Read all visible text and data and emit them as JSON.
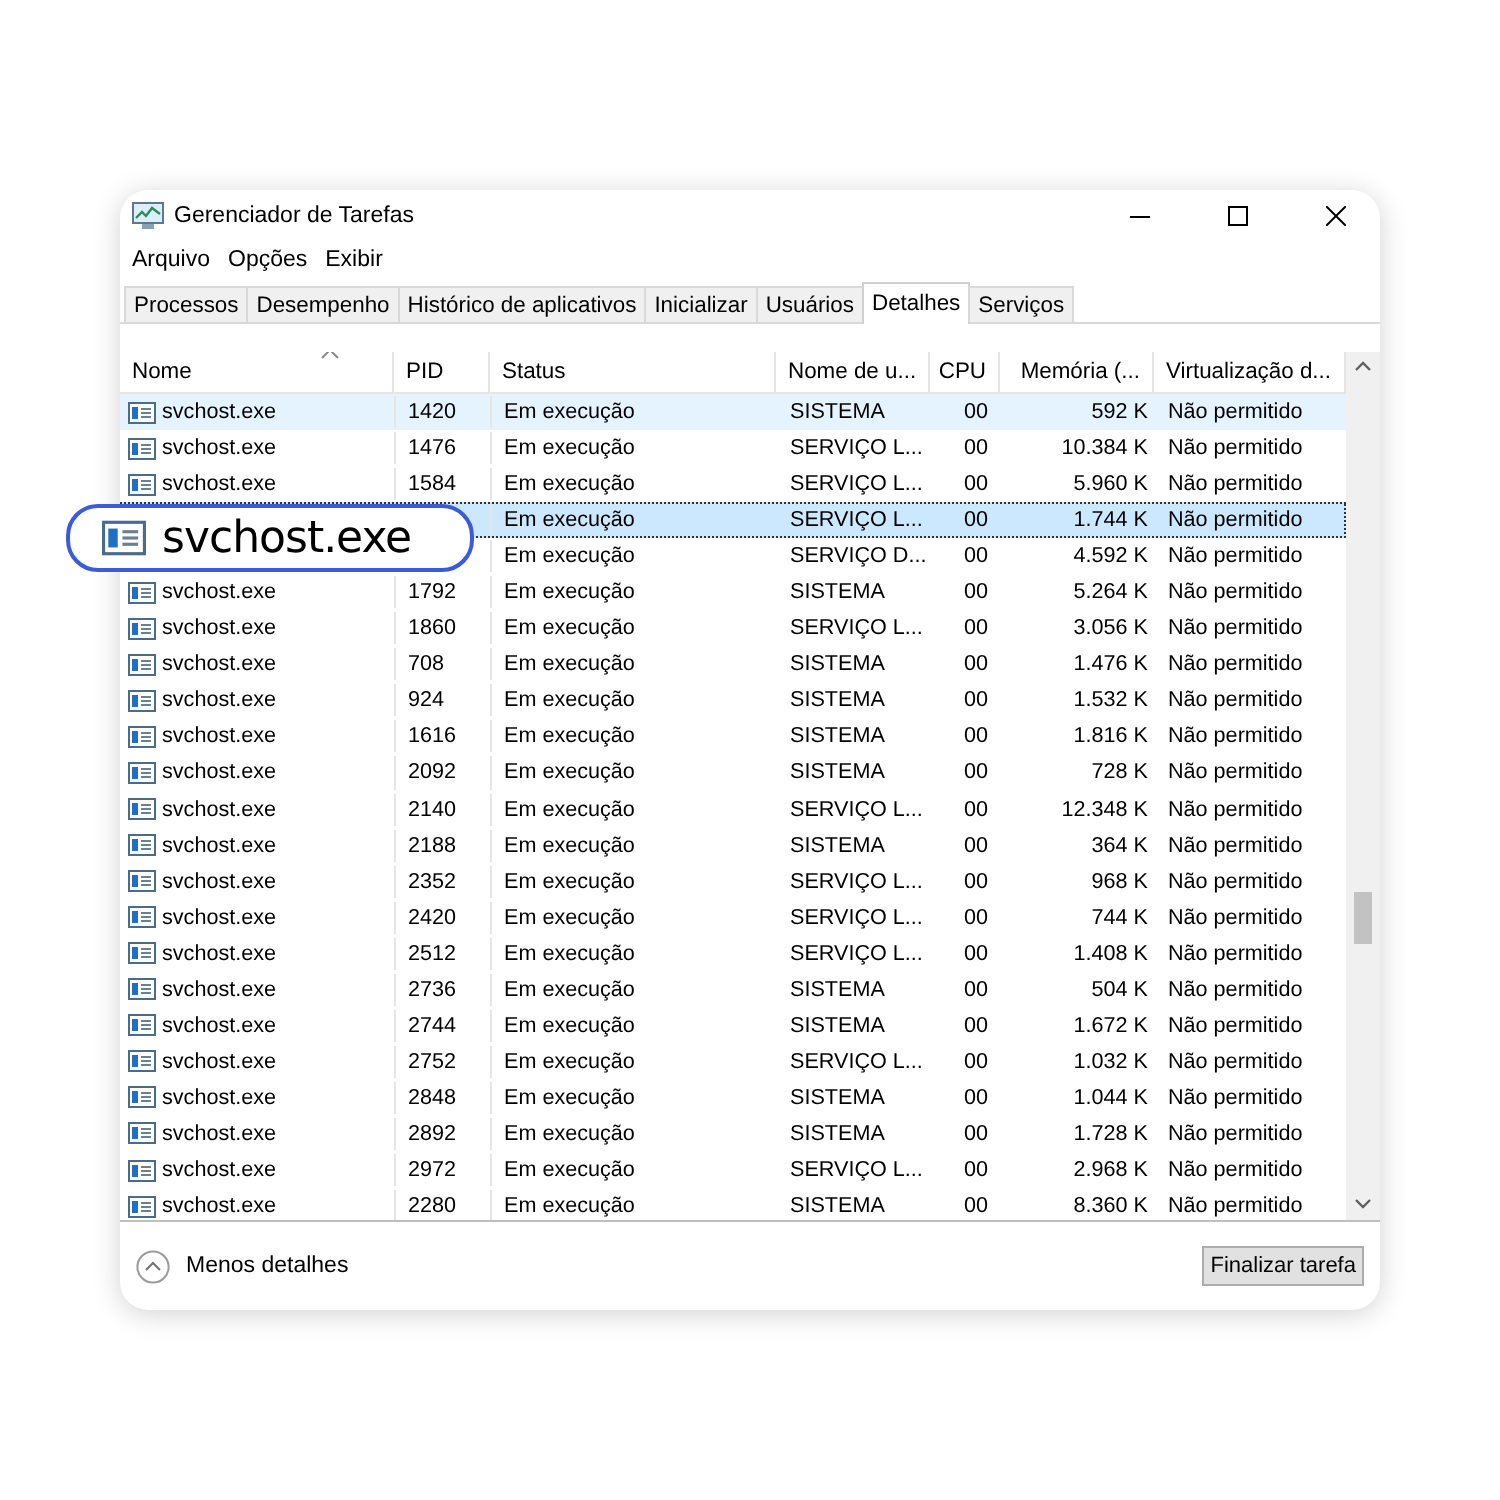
{
  "window": {
    "title": "Gerenciador de Tarefas"
  },
  "menu": [
    "Arquivo",
    "Opções",
    "Exibir"
  ],
  "tabs": [
    {
      "label": "Processos",
      "selected": false
    },
    {
      "label": "Desempenho",
      "selected": false
    },
    {
      "label": "Histórico de aplicativos",
      "selected": false
    },
    {
      "label": "Inicializar",
      "selected": false
    },
    {
      "label": "Usuários",
      "selected": false
    },
    {
      "label": "Detalhes",
      "selected": true
    },
    {
      "label": "Serviços",
      "selected": false
    }
  ],
  "table": {
    "columns": [
      "Nome",
      "PID",
      "Status",
      "Nome de u...",
      "CPU",
      "Memória (...",
      "Virtualização d..."
    ],
    "rows": [
      {
        "name": "svchost.exe",
        "pid": "1420",
        "status": "Em execução",
        "user": "SISTEMA",
        "cpu": "00",
        "memory": "592 K",
        "virtualization": "Não permitido",
        "hover": true,
        "selected": false
      },
      {
        "name": "svchost.exe",
        "pid": "1476",
        "status": "Em execução",
        "user": "SERVIÇO L...",
        "cpu": "00",
        "memory": "10.384 K",
        "virtualization": "Não permitido",
        "hover": false,
        "selected": false
      },
      {
        "name": "svchost.exe",
        "pid": "1584",
        "status": "Em execução",
        "user": "SERVIÇO L...",
        "cpu": "00",
        "memory": "5.960 K",
        "virtualization": "Não permitido",
        "hover": false,
        "selected": false
      },
      {
        "status": "Em execução",
        "user": "SERVIÇO L...",
        "cpu": "00",
        "memory": "1.744 K",
        "virtualization": "Não permitido",
        "hover": false,
        "selected": true
      },
      {
        "status": "Em execução",
        "user": "SERVIÇO D...",
        "cpu": "00",
        "memory": "4.592 K",
        "virtualization": "Não permitido",
        "hover": false,
        "selected": false
      },
      {
        "name": "svchost.exe",
        "pid": "1792",
        "status": "Em execução",
        "user": "SISTEMA",
        "cpu": "00",
        "memory": "5.264 K",
        "virtualization": "Não permitido",
        "hover": false,
        "selected": false
      },
      {
        "name": "svchost.exe",
        "pid": "1860",
        "status": "Em execução",
        "user": "SERVIÇO L...",
        "cpu": "00",
        "memory": "3.056 K",
        "virtualization": "Não permitido",
        "hover": false,
        "selected": false
      },
      {
        "name": "svchost.exe",
        "pid": "708",
        "status": "Em execução",
        "user": "SISTEMA",
        "cpu": "00",
        "memory": "1.476 K",
        "virtualization": "Não permitido",
        "hover": false,
        "selected": false
      },
      {
        "name": "svchost.exe",
        "pid": "924",
        "status": "Em execução",
        "user": "SISTEMA",
        "cpu": "00",
        "memory": "1.532 K",
        "virtualization": "Não permitido",
        "hover": false,
        "selected": false
      },
      {
        "name": "svchost.exe",
        "pid": "1616",
        "status": "Em execução",
        "user": "SISTEMA",
        "cpu": "00",
        "memory": "1.816 K",
        "virtualization": "Não permitido",
        "hover": false,
        "selected": false
      },
      {
        "name": "svchost.exe",
        "pid": "2092",
        "status": "Em execução",
        "user": "SISTEMA",
        "cpu": "00",
        "memory": "728 K",
        "virtualization": "Não permitido",
        "hover": false,
        "selected": false
      },
      {
        "name": "svchost.exe",
        "pid": "2140",
        "status": "Em execução",
        "user": "SERVIÇO L...",
        "cpu": "00",
        "memory": "12.348 K",
        "virtualization": "Não permitido",
        "hover": false,
        "selected": false
      },
      {
        "name": "svchost.exe",
        "pid": "2188",
        "status": "Em execução",
        "user": "SISTEMA",
        "cpu": "00",
        "memory": "364 K",
        "virtualization": "Não permitido",
        "hover": false,
        "selected": false
      },
      {
        "name": "svchost.exe",
        "pid": "2352",
        "status": "Em execução",
        "user": "SERVIÇO L...",
        "cpu": "00",
        "memory": "968 K",
        "virtualization": "Não permitido",
        "hover": false,
        "selected": false
      },
      {
        "name": "svchost.exe",
        "pid": "2420",
        "status": "Em execução",
        "user": "SERVIÇO L...",
        "cpu": "00",
        "memory": "744 K",
        "virtualization": "Não permitido",
        "hover": false,
        "selected": false
      },
      {
        "name": "svchost.exe",
        "pid": "2512",
        "status": "Em execução",
        "user": "SERVIÇO L...",
        "cpu": "00",
        "memory": "1.408 K",
        "virtualization": "Não permitido",
        "hover": false,
        "selected": false
      },
      {
        "name": "svchost.exe",
        "pid": "2736",
        "status": "Em execução",
        "user": "SISTEMA",
        "cpu": "00",
        "memory": "504 K",
        "virtualization": "Não permitido",
        "hover": false,
        "selected": false
      },
      {
        "name": "svchost.exe",
        "pid": "2744",
        "status": "Em execução",
        "user": "SISTEMA",
        "cpu": "00",
        "memory": "1.672 K",
        "virtualization": "Não permitido",
        "hover": false,
        "selected": false
      },
      {
        "name": "svchost.exe",
        "pid": "2752",
        "status": "Em execução",
        "user": "SERVIÇO L...",
        "cpu": "00",
        "memory": "1.032 K",
        "virtualization": "Não permitido",
        "hover": false,
        "selected": false
      },
      {
        "name": "svchost.exe",
        "pid": "2848",
        "status": "Em execução",
        "user": "SISTEMA",
        "cpu": "00",
        "memory": "1.044 K",
        "virtualization": "Não permitido",
        "hover": false,
        "selected": false
      },
      {
        "name": "svchost.exe",
        "pid": "2892",
        "status": "Em execução",
        "user": "SISTEMA",
        "cpu": "00",
        "memory": "1.728 K",
        "virtualization": "Não permitido",
        "hover": false,
        "selected": false
      },
      {
        "name": "svchost.exe",
        "pid": "2972",
        "status": "Em execução",
        "user": "SERVIÇO L...",
        "cpu": "00",
        "memory": "2.968 K",
        "virtualization": "Não permitido",
        "hover": false,
        "selected": false
      },
      {
        "name": "svchost.exe",
        "pid": "2280",
        "status": "Em execução",
        "user": "SISTEMA",
        "cpu": "00",
        "memory": "8.360 K",
        "virtualization": "Não permitido",
        "hover": false,
        "selected": false
      }
    ]
  },
  "callout": {
    "text": "svchost.exe"
  },
  "footer": {
    "toggle": "Menos detalhes",
    "button": "Finalizar tarefa"
  }
}
